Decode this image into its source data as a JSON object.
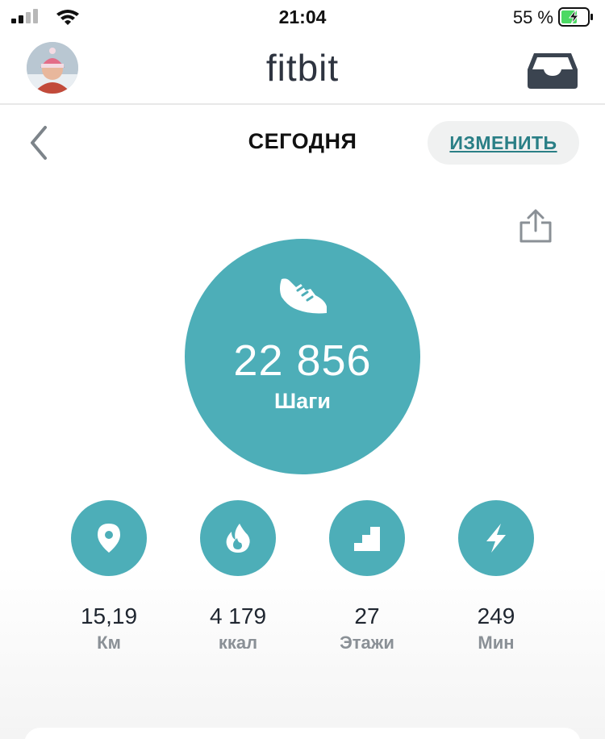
{
  "status_bar": {
    "time": "21:04",
    "battery_percent": "55 %",
    "battery_level": 0.55
  },
  "header": {
    "brand": "fitbit",
    "avatar_icon": "user-avatar",
    "inbox_icon": "inbox-icon"
  },
  "nav": {
    "title": "СЕГОДНЯ",
    "edit_label": "ИЗМЕНИТЬ",
    "back_icon": "chevron-left-icon",
    "share_icon": "share-icon"
  },
  "steps": {
    "value": "22 856",
    "label": "Шаги",
    "icon": "shoe-icon"
  },
  "stats": [
    {
      "icon": "location-pin-icon",
      "value": "15,19",
      "unit": "Км"
    },
    {
      "icon": "flame-icon",
      "value": "4 179",
      "unit": "ккал"
    },
    {
      "icon": "stairs-icon",
      "value": "27",
      "unit": "Этажи"
    },
    {
      "icon": "lightning-icon",
      "value": "249",
      "unit": "Мин"
    }
  ],
  "colors": {
    "accent": "#4daeb8",
    "link": "#2a7f86",
    "battery_charge": "#4cd964"
  }
}
